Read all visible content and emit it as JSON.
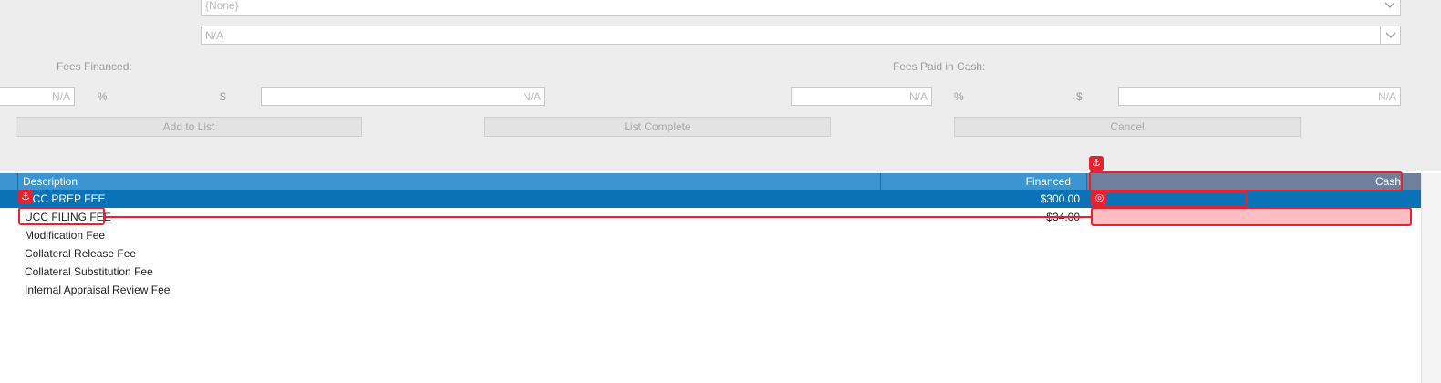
{
  "form": {
    "select1_value": "{None}",
    "select2_value": "N/A",
    "fees_financed_label": "Fees  Financed:",
    "fees_paid_cash_label": "Fees Paid in Cash:",
    "financed_pct_value": "N/A",
    "financed_pct_symbol": "%",
    "financed_dollar_symbol": "$",
    "financed_amount_value": "N/A",
    "cash_pct_value": "N/A",
    "cash_pct_symbol": "%",
    "cash_dollar_symbol": "$",
    "cash_amount_value": "N/A"
  },
  "buttons": {
    "add_to_list": "Add to List",
    "list_complete": "List Complete",
    "cancel": "Cancel"
  },
  "grid": {
    "columns": {
      "description": "Description",
      "financed": "Financed",
      "cash": "Cash"
    },
    "rows": [
      {
        "description": "UCC PREP FEE",
        "financed": "$300.00",
        "cash": "",
        "selected": true
      },
      {
        "description": "UCC FILING FEE",
        "financed": "$34.00",
        "cash": ""
      },
      {
        "description": "Modification Fee",
        "financed": "",
        "cash": ""
      },
      {
        "description": "Collateral Release Fee",
        "financed": "",
        "cash": ""
      },
      {
        "description": "Collateral Substitution Fee",
        "financed": "",
        "cash": ""
      },
      {
        "description": "Internal Appraisal Review Fee",
        "financed": "",
        "cash": ""
      }
    ]
  },
  "annotations": {
    "anchor_glyph": "⚓",
    "target_glyph": "◎",
    "color": "#e8202f"
  },
  "icons": [
    "chevron-down-icon",
    "anchor-icon",
    "target-icon"
  ]
}
